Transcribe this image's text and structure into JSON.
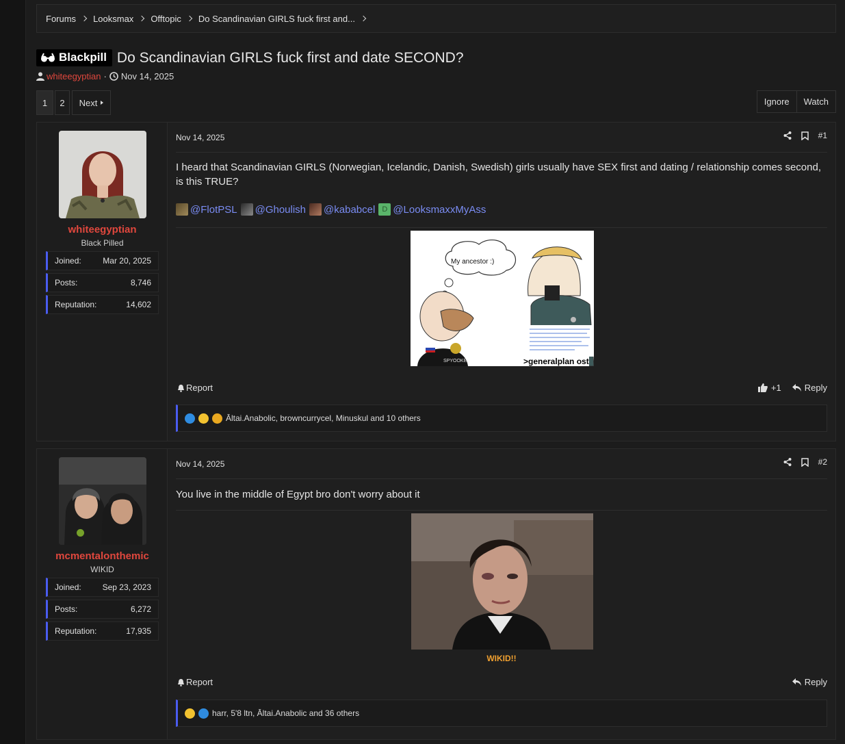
{
  "breadcrumb": [
    "Forums",
    "Looksmax",
    "Offtopic",
    "Do Scandinavian GIRLS fuck first and..."
  ],
  "thread": {
    "prefix": "Blackpill",
    "title": "Do Scandinavian GIRLS fuck first and date SECOND?",
    "author": "whiteegyptian",
    "date": "Nov 14, 2025",
    "meta_sep": "·"
  },
  "pagination": {
    "current": "1",
    "page2": "2",
    "next": "Next"
  },
  "thread_actions": {
    "ignore": "Ignore",
    "watch": "Watch"
  },
  "posts": [
    {
      "user": {
        "name": "whiteegyptian",
        "title": "Black Pilled",
        "stats": [
          {
            "label": "Joined:",
            "value": "Mar 20, 2025"
          },
          {
            "label": "Posts:",
            "value": "8,746"
          },
          {
            "label": "Reputation:",
            "value": "14,602"
          }
        ]
      },
      "date": "Nov 14, 2025",
      "number": "#1",
      "body": "I heard that Scandinavian GIRLS (Norwegian, Icelandic, Danish, Swedish) girls usually have SEX first and dating / relationship comes second, is this TRUE?",
      "mentions": [
        "@FlotPSL",
        "@Ghoulish",
        "@kababcel",
        "@LooksmaxxMyAss"
      ],
      "mention_initial": "D",
      "meme": {
        "thought": "My ancestor :)",
        "caption": ">generalplan ost",
        "shirt_text": "SPYOOKE"
      },
      "report": "Report",
      "like_count": "+1",
      "reply": "Reply",
      "reactions_text": "Āltai.Anabolic, browncurrycel, Minuskul and 10 others"
    },
    {
      "user": {
        "name": "mcmentalonthemic",
        "title": "WIKID",
        "stats": [
          {
            "label": "Joined:",
            "value": "Sep 23, 2023"
          },
          {
            "label": "Posts:",
            "value": "6,272"
          },
          {
            "label": "Reputation:",
            "value": "17,935"
          }
        ]
      },
      "date": "Nov 14, 2025",
      "number": "#2",
      "body": "You live in the middle of Egypt bro don't worry about it",
      "caption": "WIKID!!",
      "report": "Report",
      "reply": "Reply",
      "reactions_text": "harr, 5'8 ltn, Āltai.Anabolic and 36 others"
    }
  ],
  "colors": {
    "accent_red": "#e0473d",
    "link_blue": "#7a8cf3",
    "bar_blue": "#4a5cf0",
    "caption_orange": "#f0a030",
    "online_green": "#76a12a"
  }
}
